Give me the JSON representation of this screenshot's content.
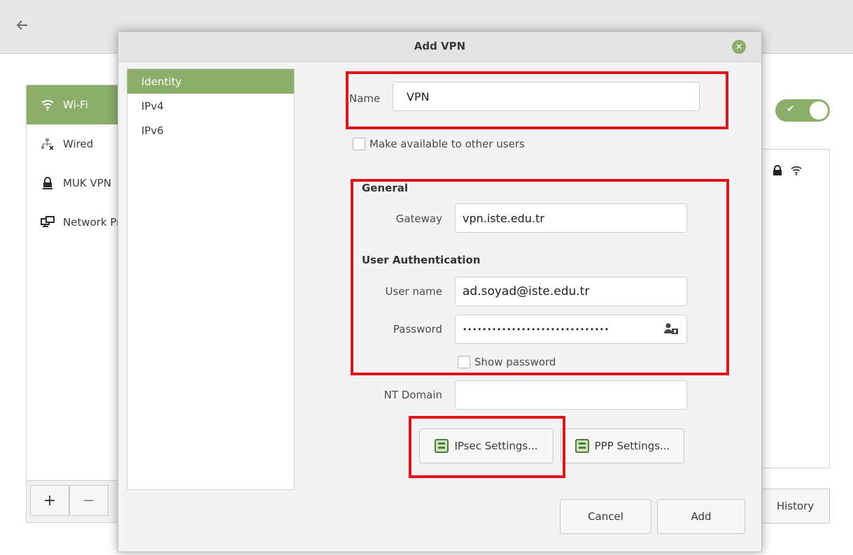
{
  "background": {
    "back_icon": "back-arrow-icon",
    "sidebar": {
      "items": [
        {
          "label": "Wi-Fi",
          "icon": "wifi-icon",
          "active": true
        },
        {
          "label": "Wired",
          "icon": "wired-icon",
          "active": false
        },
        {
          "label": "MUK VPN",
          "icon": "vpn-lock-icon",
          "active": false
        },
        {
          "label": "Network Proxy",
          "icon": "network-icon",
          "active": false
        }
      ],
      "add_label": "+",
      "remove_label": "−"
    },
    "toggle_on": true,
    "history_label": "History"
  },
  "dialog": {
    "title": "Add VPN",
    "tabs": [
      "Identity",
      "IPv4",
      "IPv6"
    ],
    "active_tab": "Identity",
    "name_label": "Name",
    "name_value": "VPN",
    "make_available_label": "Make available to other users",
    "general_heading": "General",
    "gateway_label": "Gateway",
    "gateway_value": "vpn.iste.edu.tr",
    "user_auth_heading": "User Authentication",
    "username_label": "User name",
    "username_value": "ad.soyad@iste.edu.tr",
    "password_label": "Password",
    "password_value": "••••••••••••••••••••••••••••••",
    "show_password_label": "Show password",
    "nt_domain_label": "NT Domain",
    "nt_domain_value": "",
    "ipsec_label": "IPsec Settings...",
    "ppp_label": "PPP Settings...",
    "cancel_label": "Cancel",
    "add_label": "Add"
  },
  "colors": {
    "accent": "#8bae6b",
    "highlight_box": "#e0131a"
  }
}
